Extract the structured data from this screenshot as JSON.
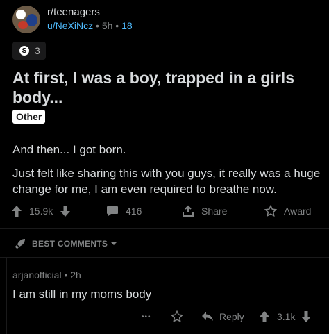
{
  "post": {
    "subreddit": "r/teenagers",
    "author": "u/NeXiNcz",
    "age": "5h",
    "score_small": "18",
    "awards_count": "3",
    "title": "At first, I was a boy, trapped in a girls body...",
    "flair": "Other",
    "body_line1": "And then... I got born.",
    "body_line2": "Just felt like sharing this with you guys, it really was a huge change for me, I am even required to breathe now."
  },
  "actions": {
    "upvotes": "15.9k",
    "comments": "416",
    "share": "Share",
    "award": "Award"
  },
  "sort": {
    "label": "BEST COMMENTS"
  },
  "comment": {
    "author": "arjanofficial",
    "age": "2h",
    "body": "I am still in my moms body",
    "reply": "Reply",
    "score": "3.1k",
    "more": "•••"
  },
  "icons": {
    "upvote": "arrow-up-icon",
    "downvote": "arrow-down-icon",
    "comment": "comment-bubble-icon",
    "share": "share-icon",
    "award": "award-icon",
    "sort": "rocket-icon"
  },
  "colors": {
    "background": "#000000",
    "text": "#d7dadc",
    "muted": "#818384",
    "link": "#4fbcff"
  }
}
